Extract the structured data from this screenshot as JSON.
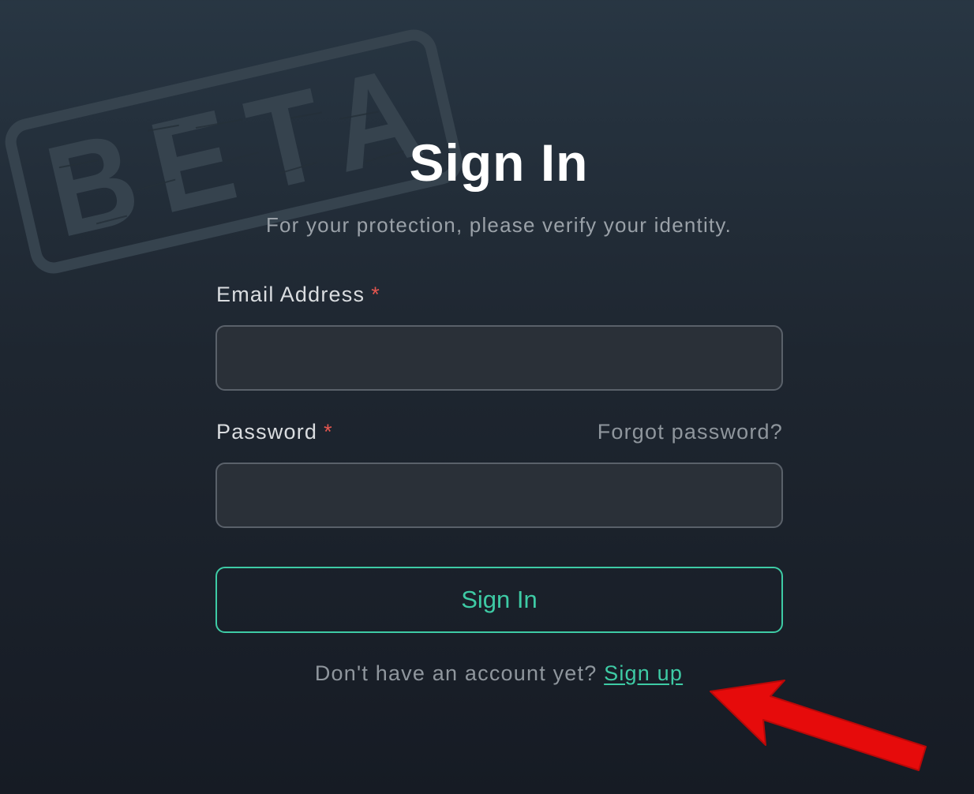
{
  "stamp": {
    "text": "BETA"
  },
  "header": {
    "title": "Sign In",
    "subtitle": "For your protection, please verify your identity."
  },
  "form": {
    "email": {
      "label": "Email Address",
      "required_mark": "*",
      "value": "",
      "placeholder": ""
    },
    "password": {
      "label": "Password",
      "required_mark": "*",
      "value": "",
      "placeholder": "",
      "forgot_label": "Forgot password?"
    },
    "submit_label": "Sign In"
  },
  "footer": {
    "prompt": "Don't have an account yet?",
    "signup_label": "Sign up"
  },
  "colors": {
    "accent": "#3ecba5",
    "required": "#e4564f",
    "arrow": "#e60b0b"
  },
  "icons": {
    "annotation": "arrow-pointing-icon"
  }
}
